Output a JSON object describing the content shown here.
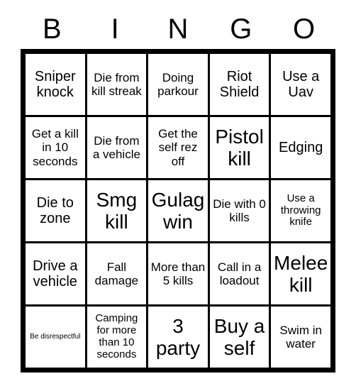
{
  "card": {
    "header_letters": [
      "B",
      "I",
      "N",
      "G",
      "O"
    ],
    "columns": 5,
    "rows": 5,
    "colors": {
      "background": "#ffffff",
      "grid_line": "#000000",
      "text": "#000000",
      "cell_background": "#ffffff"
    },
    "cells": [
      {
        "text": "Sniper knock",
        "size": "lg"
      },
      {
        "text": "Die from kill streak",
        "size": "md"
      },
      {
        "text": "Doing parkour",
        "size": "md"
      },
      {
        "text": "Riot Shield",
        "size": "lg"
      },
      {
        "text": "Use a Uav",
        "size": "lg"
      },
      {
        "text": "Get a kill in 10 seconds",
        "size": "md"
      },
      {
        "text": "Die from a vehicle",
        "size": "md"
      },
      {
        "text": "Get the self rez off",
        "size": "md"
      },
      {
        "text": "Pistol kill",
        "size": "xl"
      },
      {
        "text": "Edging",
        "size": "lg"
      },
      {
        "text": "Die to zone",
        "size": "lg"
      },
      {
        "text": "Smg kill",
        "size": "xl"
      },
      {
        "text": "Gulag win",
        "size": "xl"
      },
      {
        "text": "Die with 0 kills",
        "size": "md"
      },
      {
        "text": "Use a throwing knife",
        "size": "sm"
      },
      {
        "text": "Drive a vehicle",
        "size": "lg"
      },
      {
        "text": "Fall damage",
        "size": "md"
      },
      {
        "text": "More than 5 kills",
        "size": "md"
      },
      {
        "text": "Call in a loadout",
        "size": "md"
      },
      {
        "text": "Melee kill",
        "size": "xl"
      },
      {
        "text": "Be disrespectful",
        "size": "xs"
      },
      {
        "text": "Camping for more than 10 seconds",
        "size": "sm"
      },
      {
        "text": "3 party",
        "size": "xl"
      },
      {
        "text": "Buy a self",
        "size": "xl"
      },
      {
        "text": "Swim in water",
        "size": "md"
      }
    ]
  }
}
